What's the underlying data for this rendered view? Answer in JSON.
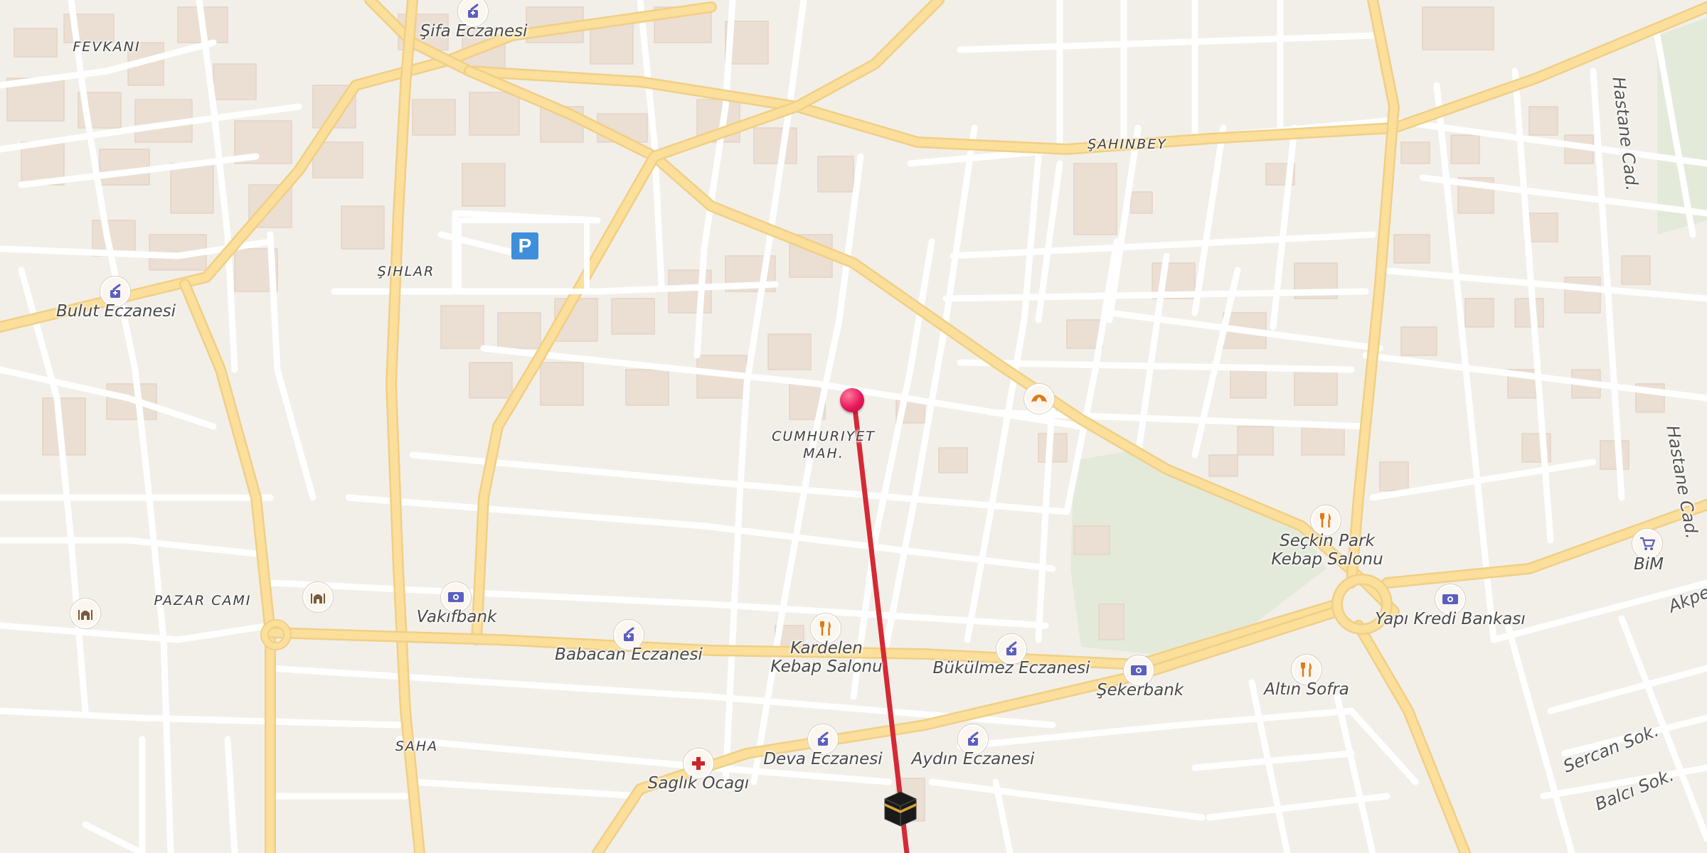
{
  "map": {
    "districts": {
      "fevkani": "FEVKANI",
      "sahinbey": "ŞAHINBEY",
      "sihlar": "ŞIHLAR",
      "cumhuriyet_line1": "CUMHURIYET",
      "cumhuriyet_line2": "MAH.",
      "pazar_cami": "PAZAR CAMI",
      "saha": "SAHA"
    },
    "streets": {
      "hastane_cad_1": "Hastane Cad.",
      "hastane_cad_2": "Hastane Cad.",
      "akpe": "Akpe",
      "sercan_sok": "Sercan Sok.",
      "balci_sok": "Balcı Sok."
    },
    "pois": {
      "sifa_eczanesi": "Şifa Eczanesi",
      "bulut_eczanesi": "Bulut Eczanesi",
      "vakifbank": "Vakıfbank",
      "babacan_eczanesi": "Babacan Eczanesi",
      "kardelen_line1": "Kardelen",
      "kardelen_line2": "Kebap Salonu",
      "bukulmez_eczanesi": "Bükülmez Eczanesi",
      "sekerbank": "Şekerbank",
      "seckin_line1": "Seçkin Park",
      "seckin_line2": "Kebap Salonu",
      "yapi_kredi": "Yapı Kredi Bankası",
      "bim": "BiM",
      "altin_sofra": "Altın Sofra",
      "deva_eczanesi": "Deva Eczanesi",
      "aydin_eczanesi": "Aydın Eczanesi",
      "saglik_ocagi": "Saglık Ocagı"
    },
    "parking_symbol": "P",
    "colors": {
      "background": "#f2efe9",
      "major_road": "#fbdf9b",
      "minor_road": "#ffffff",
      "route_line": "#d42a35",
      "pin": "#e8185a",
      "pharmacy_icon": "#5a5fc0",
      "food_icon": "#e07a14",
      "parking": "#3e8edb"
    },
    "icons": {
      "pharmacy": "pharmacy-icon",
      "bank": "bank-icon",
      "restaurant": "restaurant-icon",
      "bakery": "bakery-icon",
      "shopping": "shopping-cart-icon",
      "health": "health-cross-icon",
      "mosque": "mosque-icon",
      "kaaba": "kaaba-icon",
      "parking": "parking-icon",
      "location_pin": "location-pin-icon"
    }
  }
}
